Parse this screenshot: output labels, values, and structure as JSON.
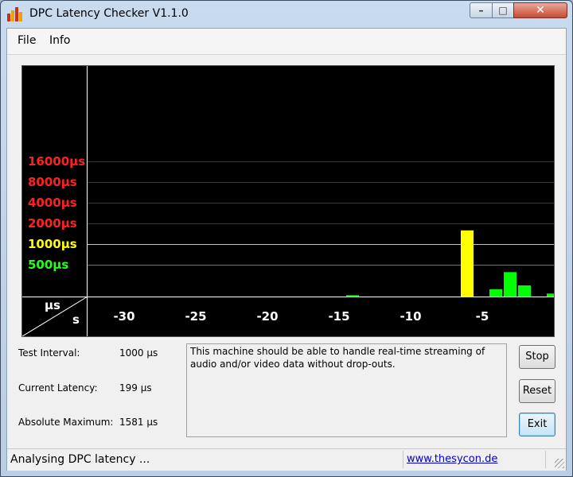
{
  "window": {
    "title": "DPC Latency Checker V1.1.0",
    "minimize": "–",
    "maximize": "□",
    "close": "✕"
  },
  "menu": {
    "file": "File",
    "info": "Info"
  },
  "graph": {
    "y_labels": [
      {
        "text": "16000µs",
        "color": "#ff2020"
      },
      {
        "text": "8000µs",
        "color": "#ff2020"
      },
      {
        "text": "4000µs",
        "color": "#ff2020"
      },
      {
        "text": "2000µs",
        "color": "#ff2020"
      },
      {
        "text": "1000µs",
        "color": "#ffff00"
      },
      {
        "text": "500µs",
        "color": "#20ff20"
      }
    ],
    "x_labels": [
      "-30",
      "-25",
      "-20",
      "-15",
      "-10",
      "-5"
    ],
    "corner_top": "µs",
    "corner_bottom": "s"
  },
  "chart_data": {
    "type": "bar",
    "y_scale": "log",
    "ylabel": "µs",
    "xlabel": "s",
    "bars_us": [
      100,
      100,
      120,
      110,
      105,
      105,
      130,
      115,
      140,
      140,
      105,
      115,
      105,
      105,
      105,
      100,
      120,
      110,
      180,
      105,
      100,
      100,
      110,
      100,
      100,
      110,
      1581,
      150,
      220,
      390,
      250,
      170,
      190
    ],
    "bar_colors": {
      "normal": "#00ff00",
      "warning": "#ffff00"
    },
    "threshold_lines": [
      {
        "value": 500,
        "color": "#00c000"
      },
      {
        "value": 1000,
        "color": "#e0e000"
      },
      {
        "value": 2000,
        "color": "#c00000"
      },
      {
        "value": 4000,
        "color": "#c00000"
      },
      {
        "value": 8000,
        "color": "#c00000"
      },
      {
        "value": 16000,
        "color": "#c00000"
      }
    ]
  },
  "stats": {
    "test_interval_label": "Test Interval:",
    "test_interval_value": "1000 µs",
    "current_latency_label": "Current Latency:",
    "current_latency_value": "199 µs",
    "absolute_maximum_label": "Absolute Maximum:",
    "absolute_maximum_value": "1581 µs"
  },
  "message": "This machine should be able to handle real-time streaming of audio and/or video data without drop-outs.",
  "buttons": {
    "stop": "Stop",
    "reset": "Reset",
    "exit": "Exit"
  },
  "status": {
    "text": "Analysing DPC latency ...",
    "link": "www.thesycon.de"
  }
}
